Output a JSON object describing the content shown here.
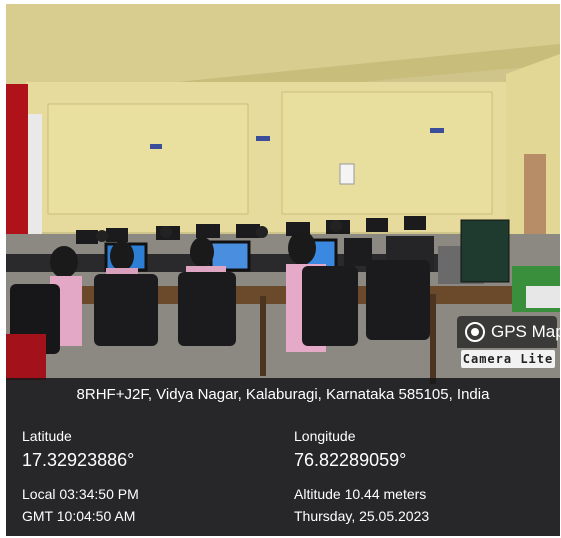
{
  "photo": {
    "scene": "computer-lab-classroom",
    "colors": {
      "wall": "#e4d89a",
      "floor": "#8a8780",
      "overlay": "#16161a"
    }
  },
  "badge": {
    "title": "GPS Map",
    "subtitle": "Camera Lite",
    "icon": "location-pin-icon"
  },
  "geo": {
    "address": "8RHF+J2F, Vidya Nagar, Kalaburagi, Karnataka 585105, India",
    "latitude_label": "Latitude",
    "latitude_value": "17.32923886°",
    "longitude_label": "Longitude",
    "longitude_value": "76.82289059°",
    "local_time": "Local 03:34:50 PM",
    "gmt_time": "GMT 10:04:50 AM",
    "altitude": "Altitude 10.44 meters",
    "date": "Thursday, 25.05.2023"
  }
}
